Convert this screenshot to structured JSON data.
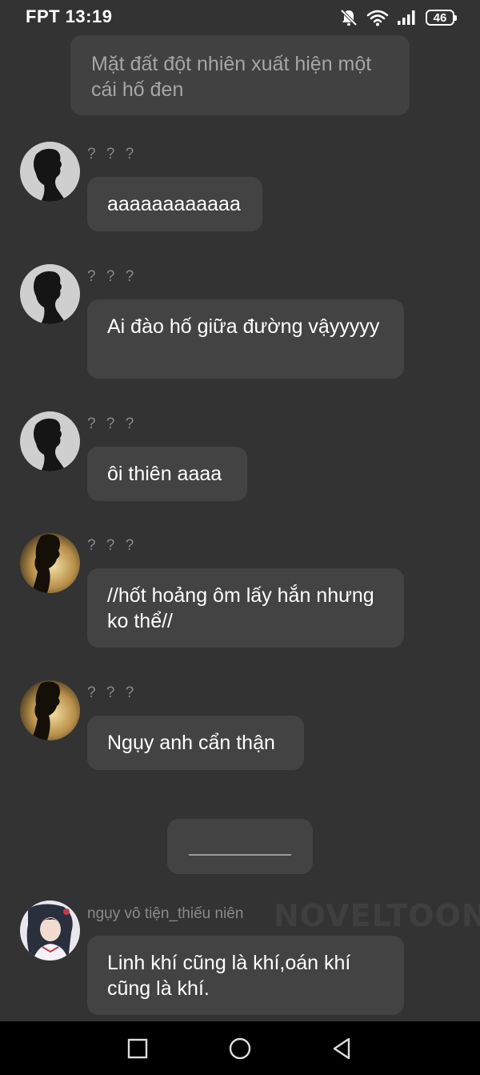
{
  "status_bar": {
    "carrier_time": "FPT 13:19",
    "battery": "46"
  },
  "narration": "Mặt đất đột nhiên xuất hiện một cái hố đen",
  "messages": [
    {
      "sender": "? ? ?",
      "text": "aaaaaaaaaaaa",
      "avatar": "dark-silhouette"
    },
    {
      "sender": "? ? ?",
      "text": "Ai đào hố giữa đường vậyyyyy",
      "avatar": "dark-silhouette"
    },
    {
      "sender": "? ? ?",
      "text": "ôi thiên aaaa",
      "avatar": "dark-silhouette"
    },
    {
      "sender": "? ? ?",
      "text": "//hốt hoảng ôm lấy hắn nhưng ko thể//",
      "avatar": "golden-silhouette"
    },
    {
      "sender": "? ? ?",
      "text": "Ngụy anh cẩn thận",
      "avatar": "golden-silhouette"
    },
    {
      "sender": "ngụy vô tiện_thiếu niên",
      "text": "Linh khí cũng là khí,oán khí cũng là khí.",
      "avatar": "anime-character"
    }
  ],
  "watermark": "NOVELTOON",
  "nav": {
    "icons": [
      "recent-apps-icon",
      "home-icon",
      "back-icon"
    ]
  },
  "colors": {
    "background": "#333333",
    "bubble": "#434343",
    "narration_text": "#a6a6a6",
    "sender_text": "#8a8a8a"
  }
}
